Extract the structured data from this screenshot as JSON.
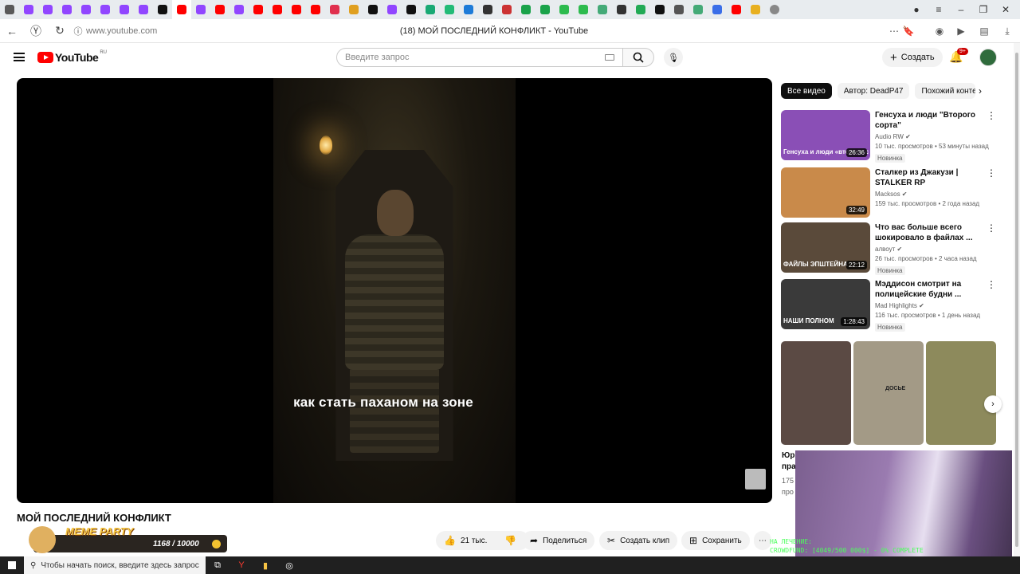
{
  "browser": {
    "tabs_count_icons": [
      "speaker",
      "twitch",
      "twitch",
      "twitch",
      "twitch",
      "twitch",
      "twitch",
      "twitch",
      "dj",
      "youtube",
      "twitch",
      "youtube",
      "twitch",
      "youtube",
      "youtube",
      "youtube",
      "youtube",
      "music",
      "d",
      "dj",
      "twitch",
      "x",
      "green",
      "globe",
      "blue",
      "news",
      "v",
      "k",
      "k",
      "clover",
      "clover",
      "doc",
      "frog",
      "phone",
      "dark",
      "grid",
      "doc",
      "web",
      "youtube",
      "m",
      "add"
    ],
    "url": "www.youtube.com",
    "page_title": "(18) МОЙ ПОСЛЕДНИЙ КОНФЛИКТ - YouTube"
  },
  "youtube": {
    "logo_text": "YouTube",
    "logo_region": "RU",
    "search_placeholder": "Введите запрос",
    "create_label": "Создать",
    "notifications_badge": "9+"
  },
  "video": {
    "caption": "как стать паханом на зоне",
    "title": "МОЙ ПОСЛЕДНИЙ КОНФЛИКТ",
    "likes": "21 тыс.",
    "share_label": "Поделиться",
    "clip_label": "Создать клип",
    "save_label": "Сохранить"
  },
  "overlay_meme": {
    "name": "MEME PARTY",
    "count": "1168 / 10000"
  },
  "chips": [
    "Все видео",
    "Автор: DeadP47",
    "Похожий конте"
  ],
  "recommendations": [
    {
      "title": "Генсуха и люди \"Второго сорта\"",
      "channel": "Audio RW",
      "stats": "10 тыс. просмотров • 53 минуты назад",
      "badge": "Новинка",
      "duration": "26:36",
      "thumb_color": "#8a4fb6",
      "thumb_text": "Генсуха и люди «второго с"
    },
    {
      "title": "Сталкер из Джакузи | STALKER RP",
      "channel": "Macksos",
      "stats": "159 тыс. просмотров • 2 года назад",
      "badge": "",
      "duration": "32:49",
      "thumb_color": "#c98a4a",
      "thumb_text": ""
    },
    {
      "title": "Что вас больше всего шокировало в файлах ...",
      "channel": "алвоут",
      "stats": "26 тыс. просмотров • 2 часа назад",
      "badge": "Новинка",
      "duration": "22:12",
      "thumb_color": "#5a4a3a",
      "thumb_text": "ФАЙЛЫ ЭПШТЕЙНА"
    },
    {
      "title": "Мэддисон смотрит на полицейские будни ...",
      "channel": "Mad Highlights",
      "stats": "116 тыс. просмотров • 1 день назад",
      "badge": "Новинка",
      "duration": "1:28:43",
      "thumb_color": "#3a3a3a",
      "thumb_text": "НАШИ ПОЛНОМ"
    }
  ],
  "shorts": {
    "cut_title": "Юр",
    "cut_line2": "пра",
    "cut_views": "175",
    "cut_views2": "про",
    "colors": [
      "#5b4a44",
      "#a39a86",
      "#8d8a5c"
    ],
    "dossier_label": "ДОСЬЕ"
  },
  "stream_overlay": {
    "line1": "НА ЛЕЧЕНИЕ:",
    "line2": "CROWDFUND: [4049/500 000$] - 0% COMPLETE",
    "progress_fraction": 0.01
  },
  "taskbar": {
    "search_placeholder": "Чтобы начать поиск, введите здесь запрос"
  }
}
